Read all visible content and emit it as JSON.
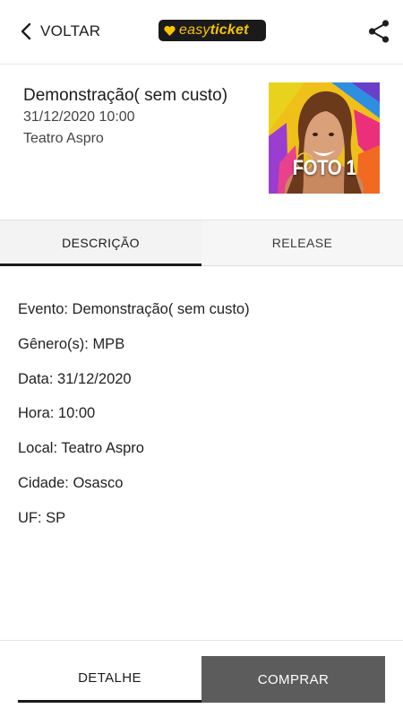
{
  "header": {
    "back_label": "VOLTAR",
    "logo_text_light": "easy",
    "logo_text_bold": "ticket",
    "logo_color": "#f8c400",
    "share_icon": "share-icon"
  },
  "event": {
    "title": "Demonstração( sem custo)",
    "datetime": "31/12/2020 10:00",
    "venue": "Teatro Aspro",
    "poster_caption": "FOTO 1"
  },
  "tabs": [
    {
      "label": "DESCRIÇÃO",
      "active": true
    },
    {
      "label": "RELEASE",
      "active": false
    }
  ],
  "details": [
    "Evento: Demonstração( sem custo)",
    "Gênero(s): MPB",
    "Data: 31/12/2020",
    "Hora: 10:00",
    "Local: Teatro Aspro",
    "Cidade: Osasco",
    "UF: SP"
  ],
  "actions": {
    "detail_label": "DETALHE",
    "buy_label": "COMPRAR",
    "buy_color": "#5c5c5c"
  }
}
